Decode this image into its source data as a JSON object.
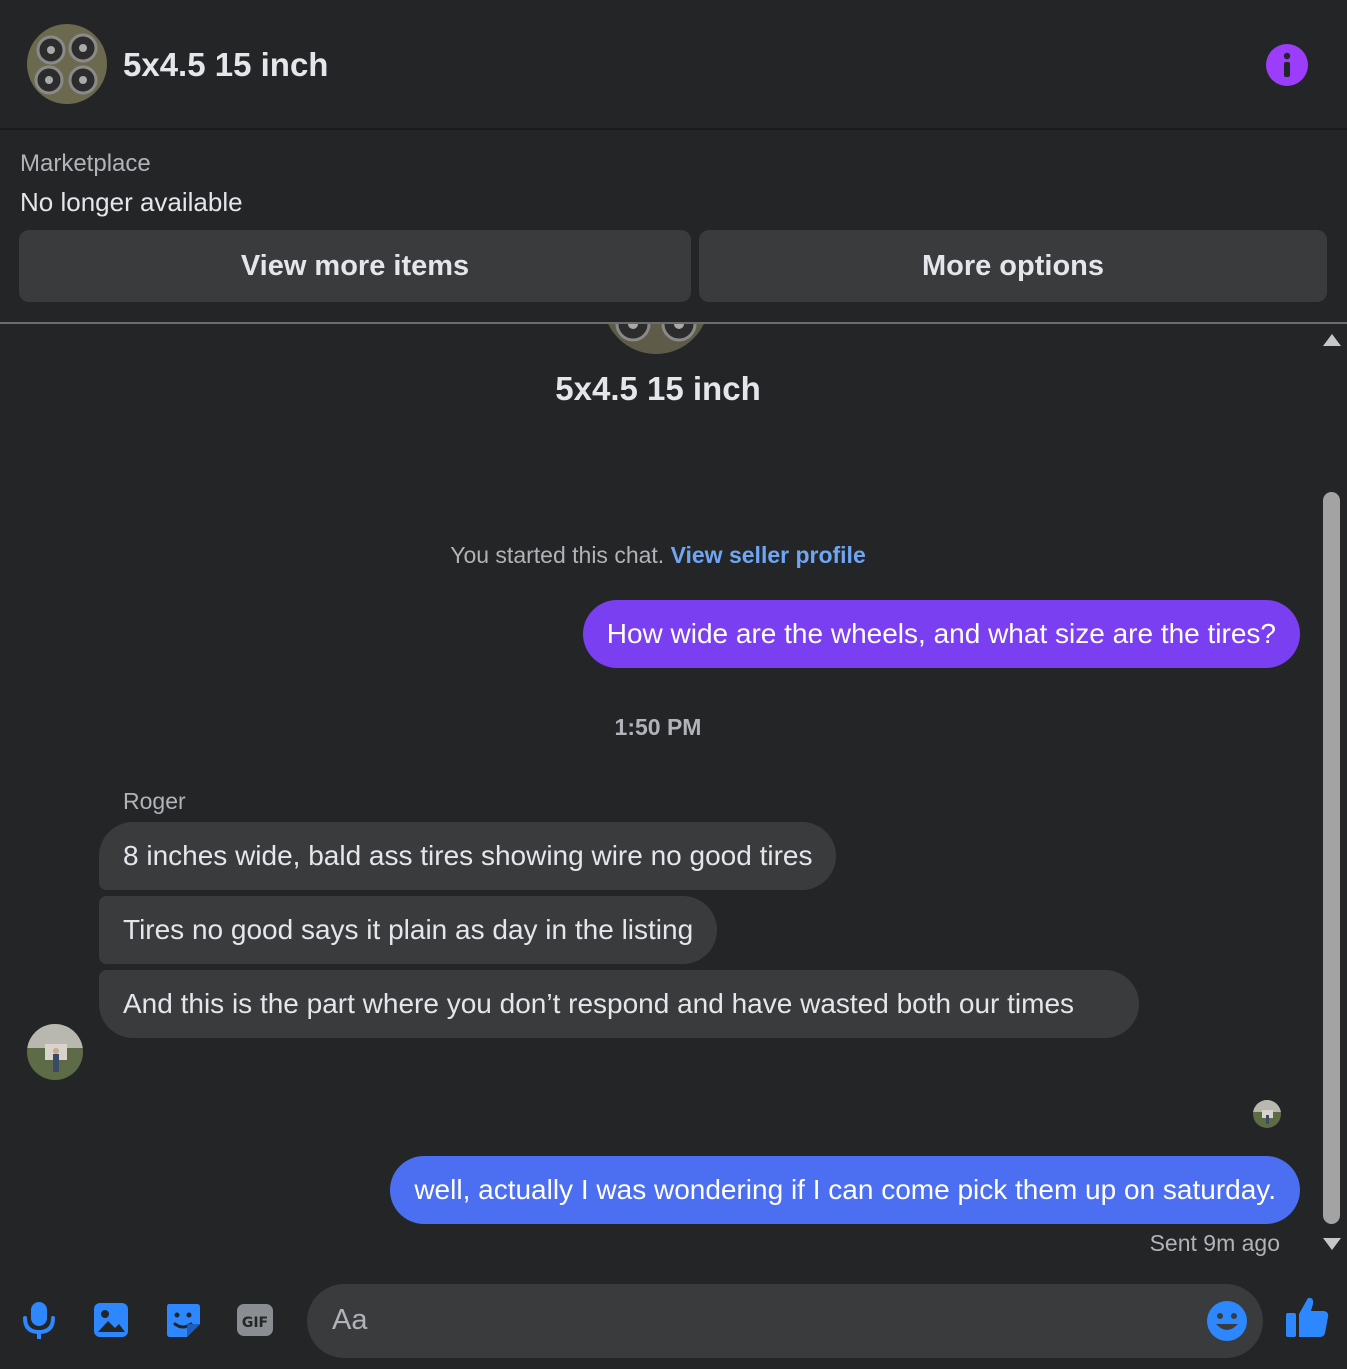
{
  "header": {
    "title": "5x4.5 15 inch"
  },
  "marketplace": {
    "label": "Marketplace",
    "status": "No longer available",
    "view_more_label": "View more items",
    "more_options_label": "More options"
  },
  "chat": {
    "title": "5x4.5 15 inch",
    "started_text": "You started this chat.",
    "seller_link": "View seller profile",
    "messages": [
      {
        "from": "me",
        "text": "How wide are the wheels, and what size are the tires?"
      },
      {
        "from": "Roger",
        "text": "8 inches wide, bald ass tires showing wire no good tires"
      },
      {
        "from": "Roger",
        "text": "Tires no good says it plain as day in the listing"
      },
      {
        "from": "Roger",
        "text": "And this is the part where you don’t respond and have wasted both our times"
      },
      {
        "from": "me",
        "text": "well, actually I was wondering if I can come pick them up on saturday."
      }
    ],
    "timestamp": "1:50 PM",
    "sender_name": "Roger",
    "sent_status": "Sent 9m ago"
  },
  "composer": {
    "placeholder": "Aa",
    "icons": [
      "microphone-icon",
      "image-icon",
      "sticker-icon",
      "gif-icon",
      "emoji-icon",
      "thumbs-up-icon"
    ]
  },
  "colors": {
    "background": "#242526",
    "bubble_mine_first": "#7b3ff2",
    "bubble_mine_last": "#4c6ef0",
    "bubble_theirs": "#3a3b3c",
    "accent": "#9b3dfb",
    "icon_blue": "#2d88ff"
  }
}
